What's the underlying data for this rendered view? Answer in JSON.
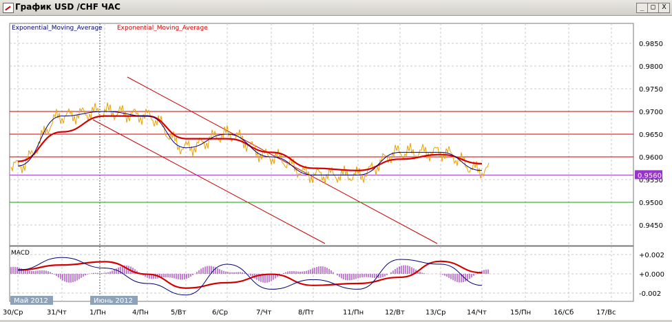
{
  "window": {
    "title": "График USD /CHF ЧАС",
    "buttons": {
      "minimize": "_",
      "restore": "□",
      "close": "X"
    }
  },
  "indicator_labels": [
    "Exponential_Moving_Average",
    "Exponential_Moving_Average"
  ],
  "colors": {
    "price": "#e8a100",
    "ema_fast": "#00007a",
    "ema_slow": "#d40000",
    "level_lines": "#cc0000",
    "support_line": "#00aa00",
    "purple_line": "#9933cc",
    "histogram": "#8800aa",
    "grid": "#c8c8c8"
  },
  "price_axis": {
    "ticks": [
      "0.9850",
      "0.9800",
      "0.9750",
      "0.9700",
      "0.9650",
      "0.9600",
      "0.9550",
      "0.9500",
      "0.9450"
    ],
    "current_price": "0.9560"
  },
  "macd": {
    "label": "MACD",
    "ticks": [
      "+0.002",
      "+0.000",
      "-0.002"
    ]
  },
  "time_axis": {
    "labels": [
      "30/Ср",
      "31/Чт",
      "1/Пн",
      "4/Пн",
      "5/Вт",
      "6/Ср",
      "7/Чт",
      "8/Пт",
      "11/Пн",
      "12/Вт",
      "13/Ср",
      "14/Чт",
      "15/Пн",
      "16/Сб",
      "17/Вс"
    ],
    "month_tags": [
      "Май 2012",
      "Июнь 2012"
    ]
  },
  "chart_data": {
    "type": "line",
    "symbol": "USD/CHF",
    "timeframe": "H1",
    "x": [
      "30/Ср",
      "31/Чт",
      "1/Пн",
      "4/Пн",
      "5/Вт",
      "6/Ср",
      "7/Чт",
      "8/Пт",
      "11/Пн",
      "12/Вт",
      "13/Ср",
      "14/Чт"
    ],
    "ylim": [
      0.942,
      0.988
    ],
    "series": [
      {
        "name": "Exponential_Moving_Average",
        "values": [
          0.958,
          0.969,
          0.97,
          0.969,
          0.962,
          0.965,
          0.96,
          0.956,
          0.956,
          0.961,
          0.961,
          0.957
        ]
      },
      {
        "name": "Exponential_Moving_Average",
        "values": [
          0.959,
          0.9655,
          0.969,
          0.969,
          0.964,
          0.964,
          0.961,
          0.9575,
          0.957,
          0.9595,
          0.9605,
          0.9585
        ]
      }
    ],
    "horizontal_levels": [
      0.97,
      0.965,
      0.96,
      0.956,
      0.95
    ],
    "macd": {
      "ylim": [
        -0.0025,
        0.0025
      ],
      "values": [
        0.0004,
        0.0017,
        0.0006,
        -0.001,
        -0.0022,
        0.001,
        -0.0016,
        -0.0006,
        -0.0016,
        0.0015,
        0.001,
        -0.0012
      ]
    }
  }
}
